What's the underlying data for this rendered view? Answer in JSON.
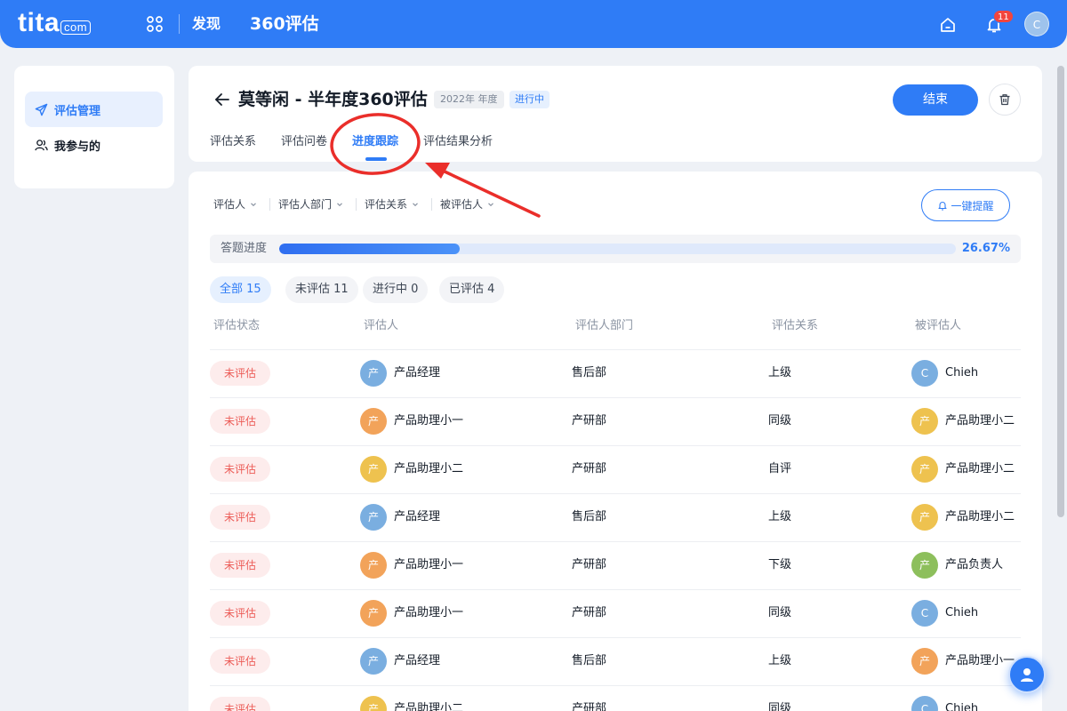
{
  "topbar": {
    "logo": "tita",
    "logo_suffix": "com",
    "nav_discover": "发现",
    "nav_360": "360评估",
    "notification_count": "11",
    "user_initial": "C"
  },
  "sidebar": {
    "items": [
      {
        "label": "评估管理",
        "icon": "send-icon",
        "active": true
      },
      {
        "label": "我参与的",
        "icon": "people-icon",
        "active": false
      }
    ]
  },
  "header": {
    "title": "莫等闲 - 半年度360评估",
    "year_tag": "2022年 年度",
    "status_tag": "进行中",
    "end_button": "结束",
    "tabs": [
      {
        "label": "评估关系",
        "active": false
      },
      {
        "label": "评估问卷",
        "active": false
      },
      {
        "label": "进度跟踪",
        "active": true
      },
      {
        "label": "评估结果分析",
        "active": false
      }
    ]
  },
  "filters": {
    "items": [
      "评估人",
      "评估人部门",
      "评估关系",
      "被评估人"
    ],
    "remind_button": "一键提醒"
  },
  "progress": {
    "label": "答题进度",
    "value": "26.67%",
    "fraction": 0.2667
  },
  "chips": [
    {
      "label": "全部 15",
      "active": true
    },
    {
      "label": "未评估 11",
      "active": false
    },
    {
      "label": "进行中 0",
      "active": false
    },
    {
      "label": "已评估 4",
      "active": false
    }
  ],
  "table": {
    "headers": [
      "评估状态",
      "评估人",
      "评估人部门",
      "评估关系",
      "被评估人"
    ],
    "rows": [
      {
        "status": "未评估",
        "evaluator_avatar": "产",
        "evaluator_color": "#7aaee0",
        "evaluator": "产品经理",
        "dept": "售后部",
        "relation": "上级",
        "target_avatar": "C",
        "target_color": "#7aaee0",
        "target": "Chieh"
      },
      {
        "status": "未评估",
        "evaluator_avatar": "产",
        "evaluator_color": "#f2a35a",
        "evaluator": "产品助理小一",
        "dept": "产研部",
        "relation": "同级",
        "target_avatar": "产",
        "target_color": "#eec24f",
        "target": "产品助理小二"
      },
      {
        "status": "未评估",
        "evaluator_avatar": "产",
        "evaluator_color": "#eec24f",
        "evaluator": "产品助理小二",
        "dept": "产研部",
        "relation": "自评",
        "target_avatar": "产",
        "target_color": "#eec24f",
        "target": "产品助理小二"
      },
      {
        "status": "未评估",
        "evaluator_avatar": "产",
        "evaluator_color": "#7aaee0",
        "evaluator": "产品经理",
        "dept": "售后部",
        "relation": "上级",
        "target_avatar": "产",
        "target_color": "#eec24f",
        "target": "产品助理小二"
      },
      {
        "status": "未评估",
        "evaluator_avatar": "产",
        "evaluator_color": "#f2a35a",
        "evaluator": "产品助理小一",
        "dept": "产研部",
        "relation": "下级",
        "target_avatar": "产",
        "target_color": "#8dbf5c",
        "target": "产品负责人"
      },
      {
        "status": "未评估",
        "evaluator_avatar": "产",
        "evaluator_color": "#f2a35a",
        "evaluator": "产品助理小一",
        "dept": "产研部",
        "relation": "同级",
        "target_avatar": "C",
        "target_color": "#7aaee0",
        "target": "Chieh"
      },
      {
        "status": "未评估",
        "evaluator_avatar": "产",
        "evaluator_color": "#7aaee0",
        "evaluator": "产品经理",
        "dept": "售后部",
        "relation": "上级",
        "target_avatar": "产",
        "target_color": "#f2a35a",
        "target": "产品助理小一"
      },
      {
        "status": "未评估",
        "evaluator_avatar": "产",
        "evaluator_color": "#eec24f",
        "evaluator": "产品助理小二",
        "dept": "产研部",
        "relation": "同级",
        "target_avatar": "C",
        "target_color": "#7aaee0",
        "target": "Chieh"
      }
    ]
  }
}
